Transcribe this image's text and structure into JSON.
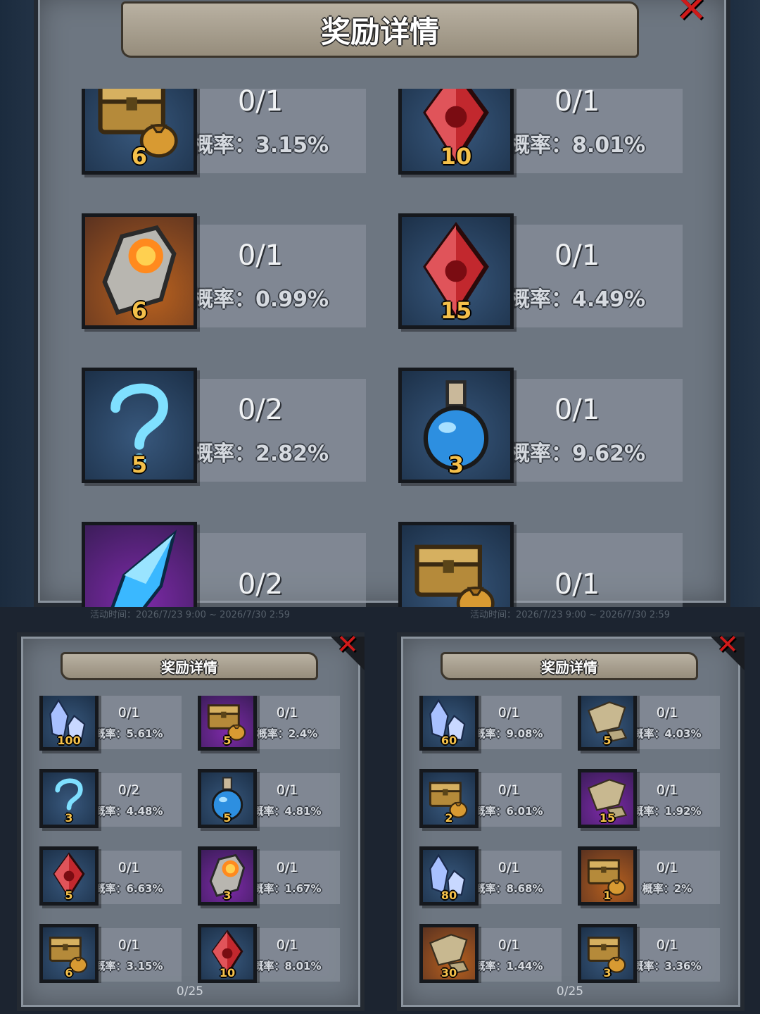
{
  "event_time": "活动时间：2026/7/23 9:00 ~ 2026/7/30 2:59",
  "close_icon": "close-x-icon",
  "top_panel": {
    "title": "奖励详情",
    "items": [
      {
        "icon": "treasure-chest-icon",
        "qty": "6",
        "count": "0/1",
        "rate": "概率：3.15%",
        "bg": "blue"
      },
      {
        "icon": "red-crystal-icon",
        "qty": "10",
        "count": "0/1",
        "rate": "概率：8.01%",
        "bg": "blue"
      },
      {
        "icon": "ember-stone-icon",
        "qty": "6",
        "count": "0/1",
        "rate": "概率：0.99%",
        "bg": "orange"
      },
      {
        "icon": "red-crystal-icon",
        "qty": "15",
        "count": "0/1",
        "rate": "概率：4.49%",
        "bg": "blue"
      },
      {
        "icon": "mystery-question-icon",
        "qty": "5",
        "count": "0/2",
        "rate": "概率：2.82%",
        "bg": "blue"
      },
      {
        "icon": "blue-potion-icon",
        "qty": "3",
        "count": "0/1",
        "rate": "概率：9.62%",
        "bg": "blue"
      },
      {
        "icon": "blue-shard-icon",
        "qty": "",
        "count": "0/2",
        "rate": "",
        "bg": "purple"
      },
      {
        "icon": "treasure-chest-icon",
        "qty": "",
        "count": "0/1",
        "rate": "",
        "bg": "blue"
      }
    ]
  },
  "left_panel": {
    "title": "奖励详情",
    "progress": "0/25",
    "items": [
      {
        "icon": "ice-crystals-icon",
        "qty": "100",
        "count": "0/1",
        "rate": "概率：5.61%",
        "bg": "blue"
      },
      {
        "icon": "treasure-chest-icon",
        "qty": "5",
        "count": "0/1",
        "rate": "概率：2.4%",
        "bg": "purple"
      },
      {
        "icon": "mystery-question-icon",
        "qty": "3",
        "count": "0/2",
        "rate": "概率：4.48%",
        "bg": "blue"
      },
      {
        "icon": "blue-potion-icon",
        "qty": "5",
        "count": "0/1",
        "rate": "概率：4.81%",
        "bg": "blue"
      },
      {
        "icon": "red-crystal-icon",
        "qty": "5",
        "count": "0/1",
        "rate": "概率：6.63%",
        "bg": "blue"
      },
      {
        "icon": "ember-stone-icon",
        "qty": "3",
        "count": "0/1",
        "rate": "概率：1.67%",
        "bg": "purple"
      },
      {
        "icon": "treasure-chest-icon",
        "qty": "6",
        "count": "0/1",
        "rate": "概率：3.15%",
        "bg": "blue"
      },
      {
        "icon": "red-crystal-icon",
        "qty": "10",
        "count": "0/1",
        "rate": "概率：8.01%",
        "bg": "blue"
      }
    ]
  },
  "right_panel": {
    "title": "奖励详情",
    "progress": "0/25",
    "items": [
      {
        "icon": "ice-crystals-icon",
        "qty": "60",
        "count": "0/1",
        "rate": "概率：9.08%",
        "bg": "blue"
      },
      {
        "icon": "map-fragment-icon",
        "qty": "5",
        "count": "0/1",
        "rate": "概率：4.03%",
        "bg": "blue"
      },
      {
        "icon": "treasure-chest-icon",
        "qty": "2",
        "count": "0/1",
        "rate": "概率：6.01%",
        "bg": "blue"
      },
      {
        "icon": "map-fragment-icon",
        "qty": "15",
        "count": "0/1",
        "rate": "概率：1.92%",
        "bg": "purple"
      },
      {
        "icon": "ice-crystals-icon",
        "qty": "80",
        "count": "0/1",
        "rate": "概率：8.68%",
        "bg": "blue"
      },
      {
        "icon": "treasure-chest-icon",
        "qty": "1",
        "count": "0/1",
        "rate": "概率：2%",
        "bg": "orange"
      },
      {
        "icon": "map-fragment-icon",
        "qty": "30",
        "count": "0/1",
        "rate": "概率：1.44%",
        "bg": "orange"
      },
      {
        "icon": "treasure-chest-icon",
        "qty": "3",
        "count": "0/1",
        "rate": "概率：3.36%",
        "bg": "blue"
      }
    ]
  }
}
